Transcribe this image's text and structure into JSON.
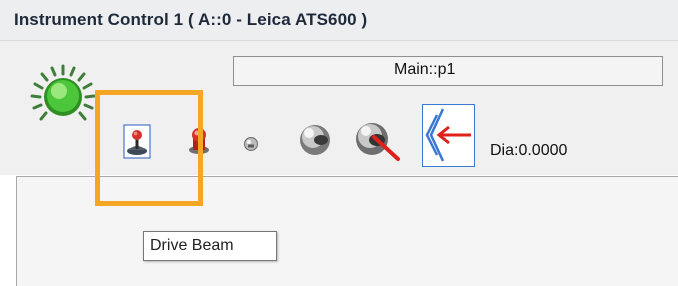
{
  "window": {
    "title": "Instrument Control 1 ( A::0 - Leica ATS600 )"
  },
  "toolbar": {
    "point_field_value": "Main::p1",
    "diameter_readout": "Dia:0.0000",
    "icons": [
      "status-led-icon",
      "joystick-icon",
      "beacon-icon",
      "small-ball-icon",
      "sphere-icon",
      "pointer-ball-icon",
      "arrow-target-icon"
    ]
  },
  "tooltip": {
    "text": "Drive Beam"
  },
  "colors": {
    "highlight": "#f5a623",
    "led_green": "#4cc63a",
    "arrow_red": "#e0201a",
    "selected_blue": "#3a78d6"
  }
}
